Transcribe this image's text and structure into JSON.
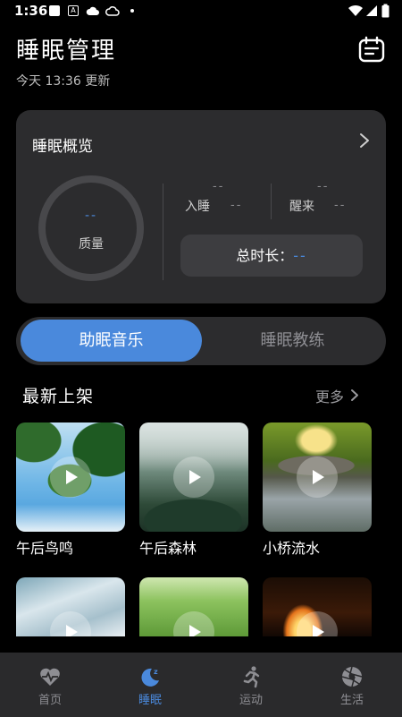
{
  "status_bar": {
    "time": "1:36"
  },
  "header": {
    "title": "睡眠管理",
    "update_text": "今天 13:36 更新"
  },
  "overview": {
    "title": "睡眠概览",
    "quality_value": "--",
    "quality_label": "质量",
    "sleep_label": "入睡",
    "sleep_top": "--",
    "sleep_value": "--",
    "wake_label": "醒来",
    "wake_top": "--",
    "wake_value": "--",
    "total_label": "总时长：",
    "total_value": "--"
  },
  "segment": {
    "active_label": "助眠音乐",
    "inactive_label": "睡眠教练"
  },
  "section": {
    "title": "最新上架",
    "more_label": "更多"
  },
  "tracks": [
    {
      "label": "午后鸟鸣"
    },
    {
      "label": "午后森林"
    },
    {
      "label": "小桥流水"
    }
  ],
  "bottom_nav": [
    {
      "label": "首页",
      "icon": "heart-pulse-icon"
    },
    {
      "label": "睡眠",
      "icon": "moon-icon"
    },
    {
      "label": "运动",
      "icon": "running-icon"
    },
    {
      "label": "生活",
      "icon": "aperture-icon"
    }
  ],
  "colors": {
    "accent": "#4a89dc",
    "card": "#2c2c2e",
    "background": "#000000"
  }
}
